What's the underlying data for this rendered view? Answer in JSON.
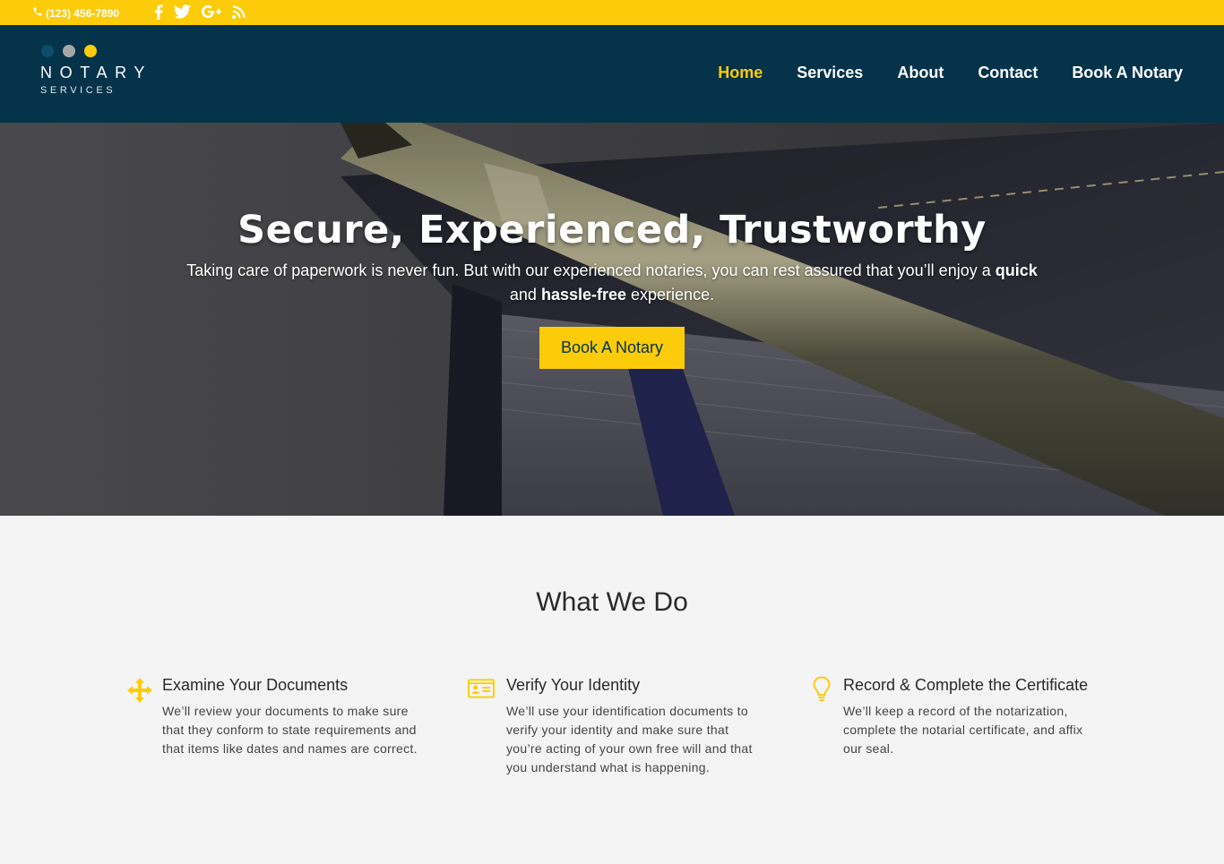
{
  "topbar": {
    "phone": "(123) 456-7890",
    "social_icons": [
      "facebook-icon",
      "twitter-icon",
      "google-plus-icon",
      "rss-icon"
    ]
  },
  "brand": {
    "name": "NOTARY",
    "tagline": "SERVICES",
    "dot_colors": [
      "#0a4e6b",
      "#a6a6a6",
      "#fccc0a"
    ]
  },
  "nav": {
    "items": [
      "Home",
      "Services",
      "About",
      "Contact",
      "Book A Notary"
    ],
    "active": "Home"
  },
  "hero": {
    "title": "Secure, Experienced, Trustworthy",
    "lead_part1": "Taking care of paperwork is never fun. But with our experienced notaries, you can rest assured that you’ll enjoy a ",
    "lead_bold1": "quick",
    "lead_part2": " and ",
    "lead_bold2": "hassle-free",
    "lead_part3": " experience.",
    "cta_label": "Book A Notary"
  },
  "what_we_do": {
    "title": "What We Do",
    "features": [
      {
        "icon": "move-arrows-icon",
        "title": "Examine Your Documents",
        "text": "We’ll review your documents to make sure that they conform to state requirements and that items like dates and names are correct."
      },
      {
        "icon": "id-card-icon",
        "title": "Verify Your Identity",
        "text": "We’ll use your identification documents to verify your identity and make sure that you’re acting of your own free will and that you understand what is happening."
      },
      {
        "icon": "lightbulb-icon",
        "title": "Record & Complete the Certificate",
        "text": "We’ll keep a record of the notarization, complete the notarial certificate, and affix our seal."
      }
    ]
  },
  "colors": {
    "accent": "#fccc0a",
    "header": "#04334a",
    "background": "#f4f4f4"
  }
}
